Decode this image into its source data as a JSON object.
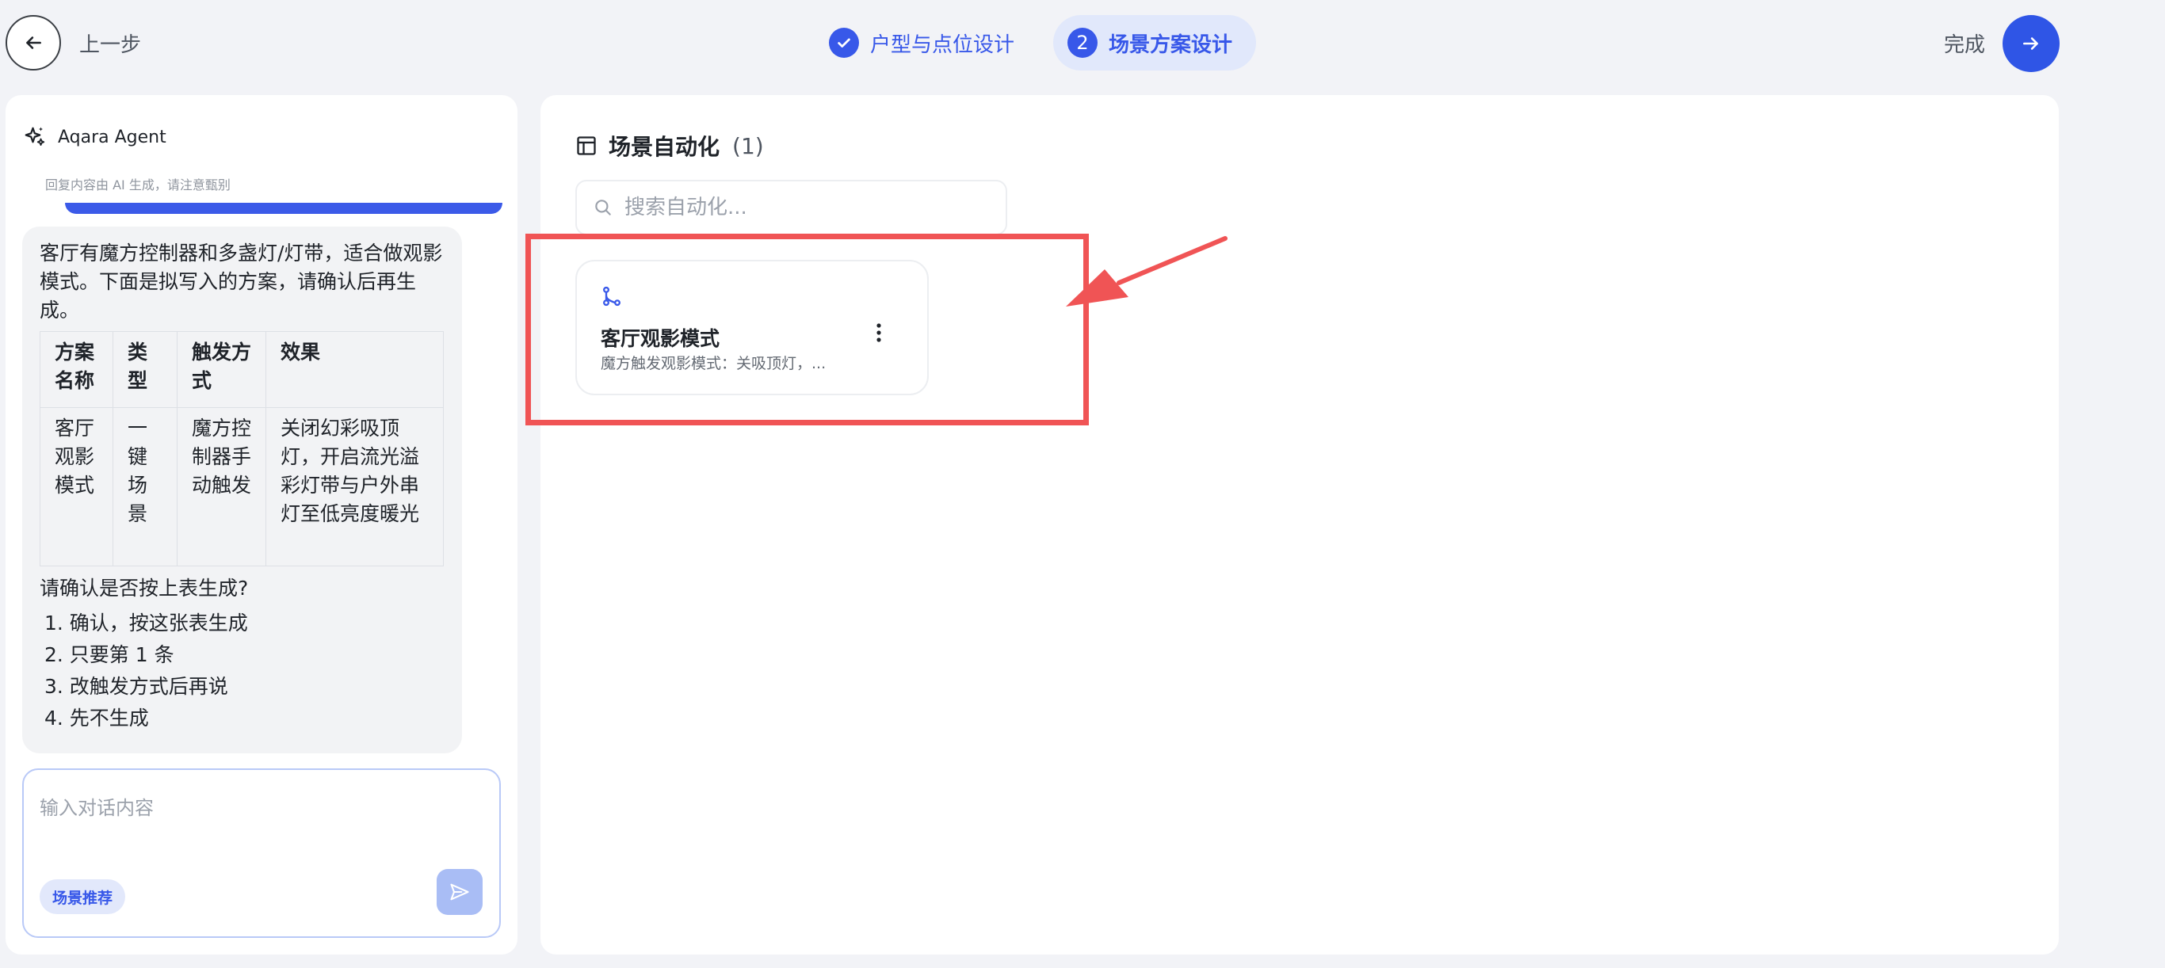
{
  "header": {
    "back_label": "上一步",
    "steps": [
      {
        "index": "1",
        "label": "户型与点位设计",
        "status": "completed"
      },
      {
        "index": "2",
        "label": "场景方案设计",
        "status": "active"
      }
    ],
    "done_label": "完成",
    "accent_color": "#3858e9"
  },
  "chat": {
    "agent_name": "Aqara Agent",
    "ai_note": "回复内容由 AI 生成，请注意甄别",
    "message": {
      "intro": "客厅有魔方控制器和多盏灯/灯带，适合做观影模式。下面是拟写入的方案，请确认后再生成。",
      "table": {
        "headers": [
          "方案名称",
          "类型",
          "触发方式",
          "效果"
        ],
        "rows": [
          [
            "客厅观影模式",
            "一键场景",
            "魔方控制器手动触发",
            "关闭幻彩吸顶灯，开启流光溢彩灯带与户外串灯至低亮度暖光"
          ]
        ]
      },
      "question": "请确认是否按上表生成?",
      "options": [
        "1. 确认，按这张表生成",
        "2. 只要第 1 条",
        "3. 改触发方式后再说",
        "4. 先不生成"
      ]
    },
    "input_placeholder": "输入对话内容",
    "chip_label": "场景推荐"
  },
  "main": {
    "section_title": "场景自动化",
    "section_count": "(1)",
    "search_placeholder": "搜索自动化...",
    "cards": [
      {
        "title": "客厅观影模式",
        "description": "魔方触发观影模式：关吸顶灯，..."
      }
    ]
  },
  "annotation_color": "#f05455"
}
